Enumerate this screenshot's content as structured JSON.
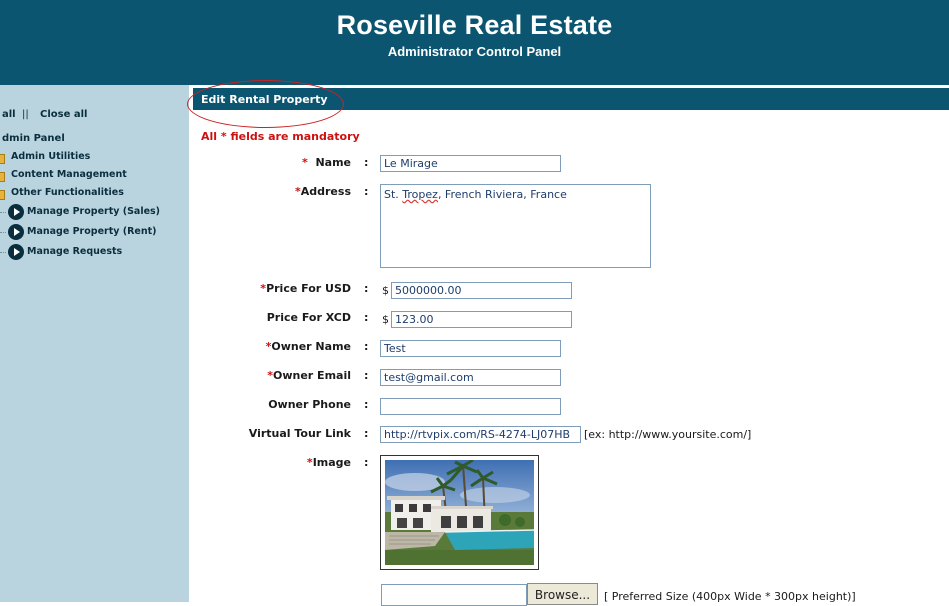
{
  "header": {
    "title": "Roseville Real Estate",
    "subtitle": "Administrator Control Panel"
  },
  "sidebar": {
    "expand_all": "all",
    "separator": "||",
    "close_all": "Close all",
    "panel_title": "dmin Panel",
    "items": [
      {
        "label": "Admin Utilities",
        "icon": "folder-icon"
      },
      {
        "label": "Content Management",
        "icon": "folder-icon"
      },
      {
        "label": "Other Functionalities",
        "icon": "folder-icon"
      },
      {
        "label": "Manage Property (Sales)",
        "icon": "arrow-circle-icon"
      },
      {
        "label": "Manage Property (Rent)",
        "icon": "arrow-circle-icon"
      },
      {
        "label": "Manage Requests",
        "icon": "arrow-circle-icon"
      }
    ]
  },
  "content": {
    "bar_title": "Edit Rental Property",
    "mandatory_note": "All * fields are mandatory",
    "required_mark": "*",
    "colon": ":",
    "currency_symbol": "$",
    "fields": {
      "name": {
        "label": "Name",
        "value": "Le Mirage"
      },
      "address": {
        "label": "Address",
        "value_pre": "St. ",
        "value_squiggle": "Tropez",
        "value_post": ", French Riviera, France"
      },
      "price_usd": {
        "label": "Price For USD",
        "value": "5000000.00"
      },
      "price_xcd": {
        "label": "Price For XCD",
        "value": "123.00"
      },
      "owner_name": {
        "label": "Owner Name",
        "value": "Test"
      },
      "owner_email": {
        "label": "Owner Email",
        "value": "test@gmail.com"
      },
      "owner_phone": {
        "label": "Owner Phone",
        "value": ""
      },
      "virtual_tour": {
        "label": "Virtual Tour Link",
        "value": "http://rtvpix.com/RS-4274-LJ07HB",
        "hint": "[ex: http://www.yoursite.com/]"
      },
      "image": {
        "label": "Image",
        "browse_label": "Browse...",
        "hint": "[ Preferred Size (400px Wide * 300px height)]"
      }
    }
  },
  "colors": {
    "header_bg": "#0c5570",
    "sidebar_bg": "#b9d4df",
    "required_red": "#cc1111"
  }
}
